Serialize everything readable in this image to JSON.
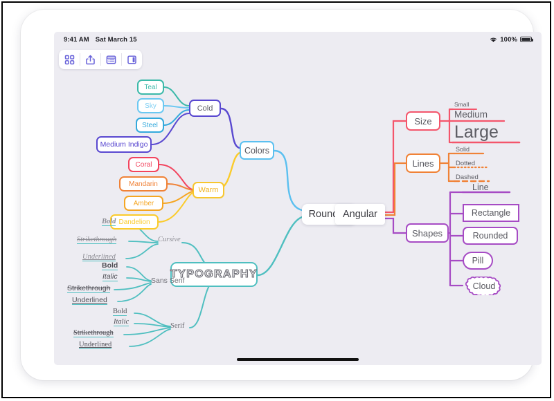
{
  "device": {
    "status_bar": {
      "time": "9:41 AM",
      "date": "Sat March 15",
      "battery_percent": "100%",
      "wifi_icon": "wifi-icon",
      "battery_icon": "battery-icon"
    },
    "home_indicator": "home-indicator"
  },
  "toolbar": {
    "buttons": [
      {
        "name": "grid-view-button",
        "icon": "grid-icon"
      },
      {
        "name": "share-button",
        "icon": "share-icon"
      },
      {
        "name": "format-list-button",
        "icon": "list-icon"
      },
      {
        "name": "panel-toggle-button",
        "icon": "panel-icon"
      }
    ]
  },
  "mindmap": {
    "roots": [
      {
        "label": "Rounded",
        "name": "root-node-rounded"
      },
      {
        "label": "Angular",
        "name": "root-node-angular"
      }
    ],
    "colors_branch": {
      "label": "Colors",
      "accent": "#5BC0F0",
      "groups": [
        {
          "label": "Cold",
          "accent": "#5948D0",
          "items": [
            {
              "label": "Teal",
              "color": "#3CB9A9"
            },
            {
              "label": "Sky",
              "color": "#6CC8F2"
            },
            {
              "label": "Steel",
              "color": "#33A9DC"
            },
            {
              "label": "Medium Indigo",
              "color": "#5948D0"
            }
          ]
        },
        {
          "label": "Warm",
          "accent": "#F7C62E",
          "items": [
            {
              "label": "Coral",
              "color": "#F2445E"
            },
            {
              "label": "Mandarin",
              "color": "#F08237"
            },
            {
              "label": "Amber",
              "color": "#F5A623"
            },
            {
              "label": "Dandelion",
              "color": "#FBCB2B"
            }
          ]
        }
      ]
    },
    "typography_branch": {
      "label": "TYPOGRAPHY",
      "accent": "#4FBFC0",
      "groups": [
        {
          "label": "Cursive",
          "items": [
            {
              "label": "Bold",
              "style": "bold"
            },
            {
              "label": "Strikethrough",
              "style": "strikethrough"
            },
            {
              "label": "Underlined",
              "style": "underline"
            }
          ]
        },
        {
          "label": "Sans Serif",
          "items": [
            {
              "label": "Bold",
              "style": "bold"
            },
            {
              "label": "Italic",
              "style": "italic"
            },
            {
              "label": "Strikethrough",
              "style": "strikethrough"
            },
            {
              "label": "Underlined",
              "style": "underline"
            }
          ]
        },
        {
          "label": "Serif",
          "items": [
            {
              "label": "Bold",
              "style": "bold"
            },
            {
              "label": "Italic",
              "style": "italic"
            },
            {
              "label": "Strikethrough",
              "style": "strikethrough"
            },
            {
              "label": "Underlined",
              "style": "underline"
            }
          ]
        }
      ]
    },
    "size_branch": {
      "label": "Size",
      "accent": "#F4556B",
      "items": [
        {
          "label": "Small",
          "size": "small"
        },
        {
          "label": "Medium",
          "size": "medium"
        },
        {
          "label": "Large",
          "size": "large"
        }
      ]
    },
    "lines_branch": {
      "label": "Lines",
      "accent": "#F08237",
      "items": [
        {
          "label": "Solid",
          "style": "solid"
        },
        {
          "label": "Dotted",
          "style": "dotted"
        },
        {
          "label": "Dashed",
          "style": "dashed"
        }
      ]
    },
    "shapes_branch": {
      "label": "Shapes",
      "accent": "#A64BC4",
      "items": [
        {
          "label": "Line",
          "shape": "line"
        },
        {
          "label": "Rectangle",
          "shape": "rectangle"
        },
        {
          "label": "Rounded",
          "shape": "rounded"
        },
        {
          "label": "Pill",
          "shape": "pill"
        },
        {
          "label": "Cloud",
          "shape": "cloud"
        }
      ]
    }
  }
}
